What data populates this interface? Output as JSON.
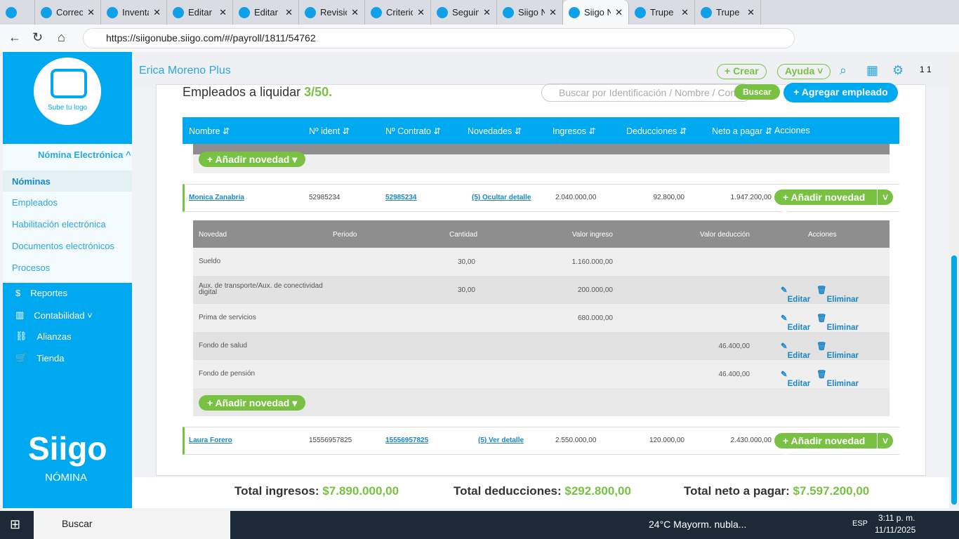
{
  "browser": {
    "tabs": [
      "",
      "Correo",
      "Inventa",
      "Editar",
      "Editar",
      "Revisió",
      "Criterio",
      "Seguim",
      "Siigo N",
      "Siigo N",
      "Trupe",
      "Trupe"
    ],
    "active_tab": 9,
    "url": "https://siigonube.siigo.com/#/payroll/1811/54762"
  },
  "sidebar": {
    "logo_text": "Sube tu logo",
    "section": "Nómina Electrónica ^",
    "sub_items": [
      "Nóminas",
      "Empleados",
      "Habilitación electrónica",
      "Documentos electrónicos",
      "Procesos"
    ],
    "items": [
      "Reportes",
      "Contabilidad ˅",
      "Alianzas",
      "Tienda"
    ],
    "brand": "Siigo",
    "brand_sub": "NÓMINA"
  },
  "header": {
    "company": "Erica Moreno Plus",
    "create": "+ Crear",
    "help": "Ayuda ˅",
    "user": "1 1"
  },
  "main": {
    "title": "Empleados a liquidar",
    "count": "3/50.",
    "search_placeholder": "Buscar por Identificación / Nombre / Contrato",
    "search_btn": "Buscar",
    "add_employee": "+ Agregar empleado",
    "columns": [
      "Nombre ⇵",
      "Nº ident ⇵",
      "Nº Contrato ⇵",
      "Novedades ⇵",
      "Ingresos ⇵",
      "Deducciones ⇵",
      "Neto a pagar ⇵",
      "Acciones"
    ],
    "add_novedad": "+ Añadir novedad ▾",
    "employees": [
      {
        "name": "Monica Zanabria",
        "ident": "52985234",
        "contract": "52985234",
        "novedades": "(5) Ocultar detalle",
        "ingresos": "2.040.000,00",
        "deducciones": "92.800,00",
        "neto": "1.947.200,00"
      },
      {
        "name": "Laura Forero",
        "ident": "15556957825",
        "contract": "15556957825",
        "novedades": "(5) Ver detalle",
        "ingresos": "2.550.000,00",
        "deducciones": "120.000,00",
        "neto": "2.430.000,00"
      }
    ],
    "detail_columns": [
      "Novedad",
      "Periodo",
      "Cantidad",
      "Valor ingreso",
      "Valor deducción",
      "Acciones"
    ],
    "detail_rows": [
      {
        "novedad": "Sueldo",
        "cantidad": "30,00",
        "ingreso": "1.160.000,00",
        "deduccion": ""
      },
      {
        "novedad": "Aux. de transporte/Aux. de conectividad digital",
        "cantidad": "30,00",
        "ingreso": "200.000,00",
        "deduccion": ""
      },
      {
        "novedad": "Prima de servicios",
        "cantidad": "",
        "ingreso": "680.000,00",
        "deduccion": ""
      },
      {
        "novedad": "Fondo de salud",
        "cantidad": "",
        "ingreso": "",
        "deduccion": "46.400,00"
      },
      {
        "novedad": "Fondo de pensión",
        "cantidad": "",
        "ingreso": "",
        "deduccion": "46.400,00"
      }
    ],
    "edit": "Editar",
    "delete": "Eliminar"
  },
  "footer": {
    "ingresos_label": "Total ingresos:",
    "ingresos": "$7.890.000,00",
    "deducciones_label": "Total deducciones:",
    "deducciones": "$292.800,00",
    "neto_label": "Total neto a pagar:",
    "neto": "$7.597.200,00"
  },
  "taskbar": {
    "search": "Buscar",
    "weather": "24°C  Mayorm. nubla...",
    "lang": "ESP",
    "time": "3:11 p. m.",
    "date": "11/11/2025"
  },
  "colors": {
    "primary": "#00a8f0",
    "green": "#79c142"
  }
}
